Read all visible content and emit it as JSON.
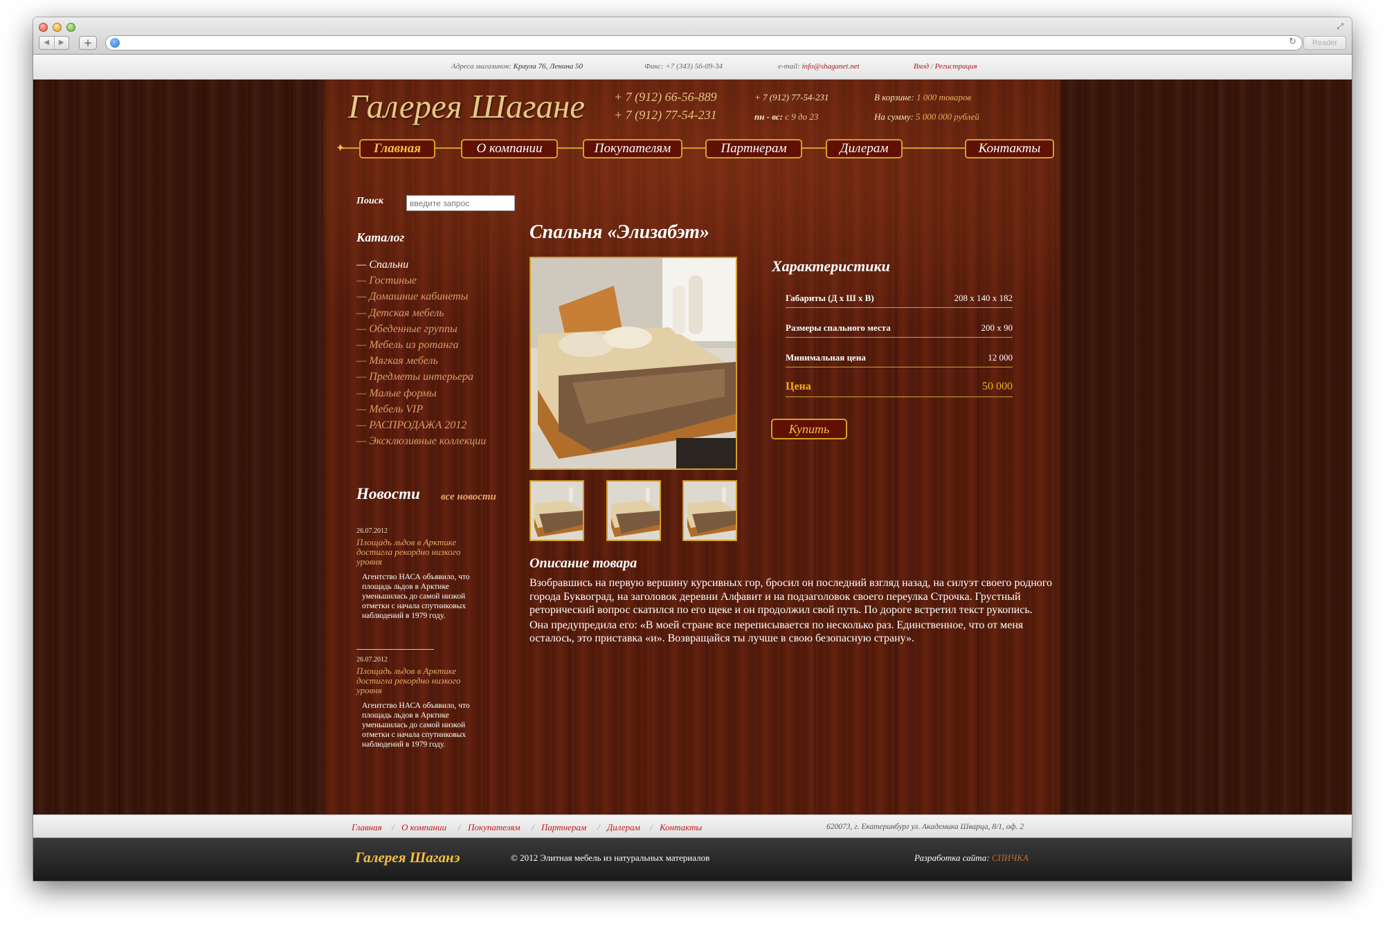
{
  "browser": {
    "reader_label": "Reader"
  },
  "topbar": {
    "addresses_label": "Адреса магазинов:",
    "addresses_value": "Краула 76, Ленина 50",
    "fax": "Факс: +7 (343) 56-09-34",
    "email_label": "e-mail:",
    "email_value": "info@shaganet.net",
    "login": "Вход",
    "slash": "/",
    "register": "Регистрация"
  },
  "header": {
    "logo": "Галерея Шагане",
    "phone1": "+ 7 (912) 66-56-889",
    "phone2": "+ 7 (912) 77-54-231",
    "phone3": "+ 7 (912) 77-54-231",
    "hours_label": "пн - вс:",
    "hours_value": "с 9 до 23",
    "cart_label": "В корзине:",
    "cart_value": "1 000 товаров",
    "sum_label": "На сумму:",
    "sum_value": "5 000 000 рублей"
  },
  "nav": {
    "items": [
      "Главная",
      "О компании",
      "Покупателям",
      "Партнерам",
      "Дилерам",
      "Контакты"
    ]
  },
  "search": {
    "label": "Поиск",
    "placeholder": "введите запрос"
  },
  "sidebar": {
    "catalog_title": "Каталог",
    "catalog": [
      "— Спальни",
      "— Гостиные",
      "— Домашние кабинеты",
      "— Детская мебель",
      "— Обеденные группы",
      "— Мебель из ротанга",
      "— Мягкая мебель",
      "— Предметы интерьера",
      "— Малые формы",
      "— Мебель VIP",
      "— РАСПРОДАЖА 2012",
      "— Эксклюзивные коллекции"
    ],
    "news_title": "Новости",
    "news_all": "все новости",
    "news": [
      {
        "date": "26.07.2012",
        "headline": "Площадь льдов в Арктике достигла рекордно низкого уровня",
        "text": "Агентство НАСА объявило, что площадь льдов в Арктике уменьшилась до самой низкой отметки с начала спутниковых наблюдений в 1979 году."
      },
      {
        "date": "26.07.2012",
        "headline": "Площадь льдов в Арктике достигла рекордно низкого уровня",
        "text": "Агентство НАСА объявило, что площадь льдов в Арктике уменьшилась до самой низкой отметки с начала спутниковых наблюдений в 1979 году."
      }
    ]
  },
  "product": {
    "title": "Спальня «Элизабэт»",
    "characteristics_title": "Характеристики",
    "specs": [
      {
        "label": "Габариты (Д х Ш х В)",
        "value": "208 х 140 х 182"
      },
      {
        "label": "Размеры спального места",
        "value": "200 х 90"
      },
      {
        "label": "Минимальная цена",
        "value": "12 000"
      }
    ],
    "price_label": "Цена",
    "price_value": "50 000",
    "buy_label": "Купить",
    "description_title": "Описание товара",
    "description": [
      "Взобравшись на первую вершину курсивных гор, бросил он последний взгляд назад, на силуэт своего родного города Буквоград, на заголовок деревни Алфавит и на подзаголовок своего переулка Строчка. Грустный реторический вопрос скатился по его щеке и он продолжил свой путь. По дороге встретил текст рукопись.",
      "Она предупредила его: «В моей стране все переписывается по несколько раз. Единственное, что от меня осталось, это приставка «и». Возвращайся ты лучше в свою безопасную страну»."
    ]
  },
  "footer": {
    "links": [
      "Главная",
      "О компании",
      "Покупателям",
      "Партнерам",
      "Дилерам",
      "Контакты"
    ],
    "separator": "/",
    "address": "620073, г. Екатеринбург ул. Академика Шварца, 8/1, оф. 2",
    "logo": "Галерея Шаганэ",
    "copyright": "© 2012 Элитная мебель из натуральных материалов",
    "dev_label": "Разработка сайта:",
    "dev_brand": "СПИЧКА"
  },
  "colors": {
    "accent_gold": "#d4a028",
    "button_bg": "#611004",
    "link_red": "#c01818",
    "wood_dark": "#3a160a"
  }
}
